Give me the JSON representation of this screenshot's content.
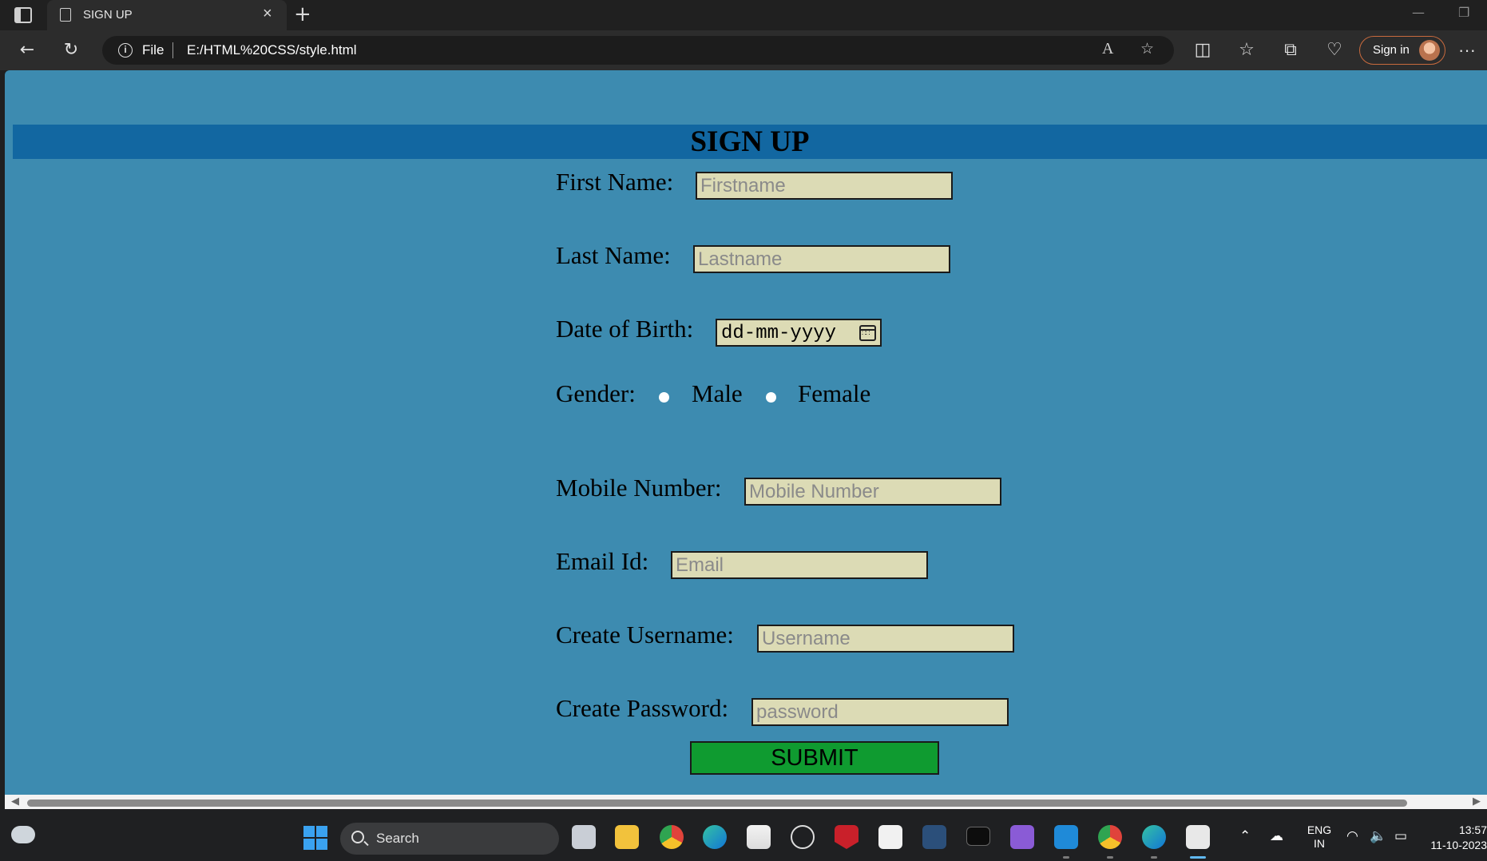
{
  "browser": {
    "tab_title": "SIGN UP",
    "tab_close": "×",
    "new_tab": "+",
    "address": {
      "scheme_label": "File",
      "url": "E:/HTML%20CSS/style.html"
    },
    "read_aloud": "A",
    "sign_in_label": "Sign in",
    "more": "···",
    "minimize": "—",
    "restore": "❐"
  },
  "page": {
    "heading": "SIGN UP",
    "form": {
      "first_name": {
        "label": "First Name:",
        "placeholder": "Firstname"
      },
      "last_name": {
        "label": "Last Name:",
        "placeholder": "Lastname"
      },
      "dob": {
        "label": "Date of Birth:",
        "placeholder": "dd-mm-yyyy"
      },
      "gender": {
        "label": "Gender:",
        "options": [
          "Male",
          "Female"
        ]
      },
      "mobile": {
        "label": "Mobile Number:",
        "placeholder": "Mobile Number"
      },
      "email": {
        "label": "Email Id:",
        "placeholder": "Email"
      },
      "username": {
        "label": "Create Username:",
        "placeholder": "Username"
      },
      "password": {
        "label": "Create Password:",
        "placeholder": "password"
      },
      "submit_label": "SUBMIT"
    }
  },
  "taskbar": {
    "search_label": "Search",
    "language": {
      "lang": "ENG",
      "region": "IN"
    },
    "time": "13:57",
    "date": "11-10-2023"
  },
  "colors": {
    "page_background": "#3d8bb0",
    "banner": "#1267a1",
    "input_background": "#dcdbb5",
    "submit": "#0f9b30"
  }
}
